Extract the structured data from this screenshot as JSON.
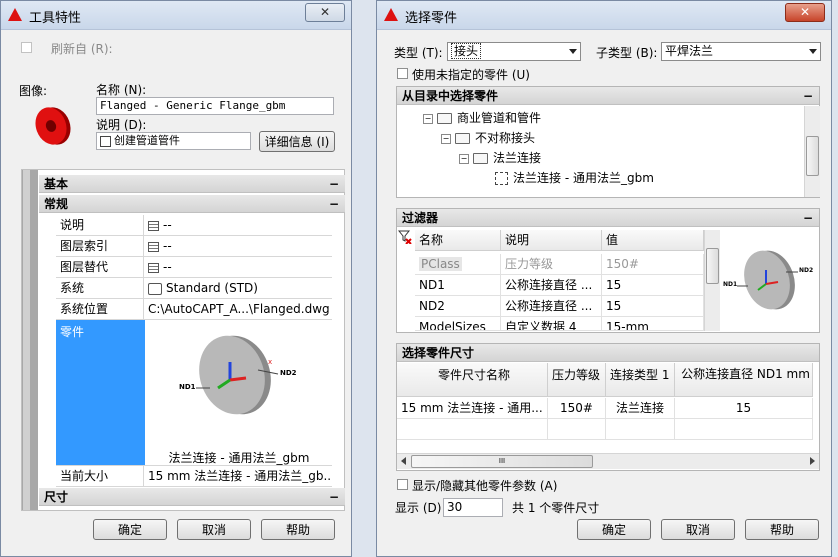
{
  "left": {
    "title": "工具特性",
    "close_label": "✕",
    "refresh_label": "刷新自 (R):",
    "image_label": "图像:",
    "name_label": "名称 (N):",
    "name_value": "Flanged - Generic Flange_gbm",
    "desc_label": "说明 (D):",
    "desc_value": "创建管道管件",
    "details_button": "详细信息 (I)",
    "basic_section": "基本",
    "general_section": "常规",
    "size_section": "尺寸",
    "rows": [
      {
        "name": "说明",
        "value": "--"
      },
      {
        "name": "图层索引",
        "value": "--"
      },
      {
        "name": "图层替代",
        "value": "--"
      },
      {
        "name": "系统",
        "value": "Standard (STD)"
      },
      {
        "name": "系统位置",
        "value": "C:\\AutoCAPT_A...\\Flanged.dwg"
      }
    ],
    "part_row_label": "零件",
    "part_caption": "法兰连接 - 通用法兰_gbm",
    "current_size_label": "当前大小",
    "current_size_value": "15 mm 法兰连接 - 通用法兰_gb...",
    "ok": "确定",
    "cancel": "取消",
    "help": "帮助",
    "collapse_glyph": "−"
  },
  "right": {
    "title": "选择零件",
    "close_label": "✕",
    "type_label": "类型 (T):",
    "type_value": "接头",
    "subtype_label": "子类型 (B):",
    "subtype_value": "平焊法兰",
    "use_unspecified": "使用未指定的零件 (U)",
    "catalog_section": "从目录中选择零件",
    "tree": [
      {
        "label": "商业管道和管件",
        "toggle": "−"
      },
      {
        "label": "不对称接头",
        "toggle": "−"
      },
      {
        "label": "法兰连接",
        "toggle": "−"
      },
      {
        "label": "法兰连接 - 通用法兰_gbm",
        "toggle": ""
      }
    ],
    "filter_section": "过滤器",
    "filter_headers": [
      "名称",
      "说明",
      "值"
    ],
    "filter_rows": [
      [
        "PClass",
        "压力等级",
        "150#"
      ],
      [
        "ND1",
        "公称连接直径 ...",
        "15"
      ],
      [
        "ND2",
        "公称连接直径 ...",
        "15"
      ],
      [
        "ModelSizes",
        "自定义数据 4",
        "15-mm"
      ]
    ],
    "size_section": "选择零件尺寸",
    "size_headers": [
      "零件尺寸名称",
      "压力等级",
      "连接类型 1",
      "公称连接直径 ND1 mm"
    ],
    "size_rows": [
      [
        "15 mm 法兰连接 - 通用...",
        "150#",
        "法兰连接",
        "15"
      ]
    ],
    "scroll_glyph": "III",
    "show_hide_label": "显示/隐藏其他零件参数 (A)",
    "display_label": "显示 (D)",
    "display_value": "30",
    "count_text": "共 1 个零件尺寸",
    "ok": "确定",
    "cancel": "取消",
    "help": "帮助",
    "collapse_glyph": "−"
  },
  "preview": {
    "nd1": "ND1",
    "nd2": "ND2"
  }
}
